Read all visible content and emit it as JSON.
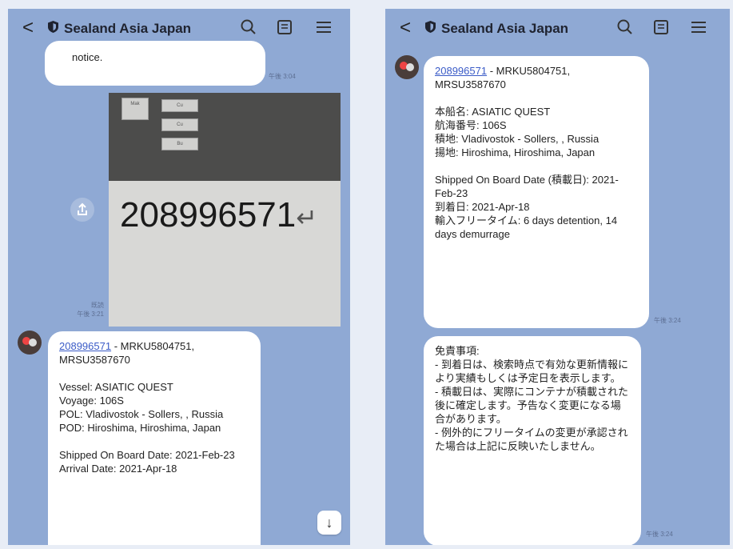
{
  "left": {
    "header": {
      "back": "<",
      "title": "Sealand Asia Japan"
    },
    "top_bubble_text": "notice.",
    "top_time": "午後 3:04",
    "photo": {
      "tracking_number": "208996571",
      "return_mark": "↵",
      "buttons": [
        "Mak",
        "Cu",
        "Cu",
        "Bu"
      ]
    },
    "photo_time_read": "既読",
    "photo_time": "午後 3:21",
    "message": {
      "link": "208996571",
      "link_suffix": " - MRKU5804751, MRSU3587670",
      "body1": "Vessel: ASIATIC QUEST\nVoyage: 106S\nPOL: Vladivostok - Sollers, , Russia\nPOD: Hiroshima, Hiroshima, Japan",
      "body2": "Shipped On Board Date: 2021-Feb-23\nArrival Date: 2021-Apr-18"
    },
    "scroll_down": "↓"
  },
  "right": {
    "header": {
      "back": "<",
      "title": "Sealand Asia Japan"
    },
    "message": {
      "link": "208996571",
      "link_suffix": " - MRKU5804751, MRSU3587670",
      "body1": "本船名: ASIATIC QUEST\n航海番号: 106S\n積地: Vladivostok - Sollers, , Russia\n揚地: Hiroshima, Hiroshima, Japan",
      "body2": "Shipped On Board Date (積載日): 2021-Feb-23\n到着日: 2021-Apr-18\n輸入フリータイム: 6 days detention, 14 days demurrage"
    },
    "message_time": "午後 3:24",
    "disclaimer": "免責事項:\n- 到着日は、検索時点で有効な更新情報により実績もしくは予定日を表示します。\n- 積載日は、実際にコンテナが積載された後に確定します。予告なく変更になる場合があります。\n- 例外的にフリータイムの変更が承認された場合は上記に反映いたしません。",
    "disclaimer_time": "午後 3:24"
  },
  "colors": {
    "chat_bg": "#8fa9d4",
    "link": "#3a5bc7",
    "bubble": "#ffffff"
  },
  "icons": [
    "back-icon",
    "shield-icon",
    "search-icon",
    "note-icon",
    "menu-icon",
    "share-icon",
    "avatar-icon",
    "scroll-down-icon"
  ]
}
